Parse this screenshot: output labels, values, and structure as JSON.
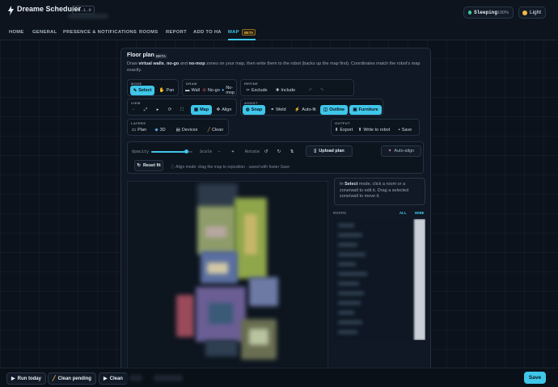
{
  "app": {
    "title": "Dreame Scheduler",
    "version": "v0.1.0"
  },
  "status": {
    "state": "Sleeping",
    "battery": "100%"
  },
  "theme": {
    "label": "Light"
  },
  "nav": {
    "items": [
      "HOME",
      "GENERAL",
      "PRESENCE & NOTIFICATIONS",
      "ROOMS",
      "REPORT",
      "ADD TO HA",
      "MAP"
    ],
    "active": "MAP",
    "map_badge": "BETA"
  },
  "panel": {
    "title": "Floor plan",
    "badge": "BETA",
    "desc_pre": "Draw ",
    "desc_walls": "virtual walls",
    "desc_mid1": ", ",
    "desc_nogo": "no-go",
    "desc_mid2": " and ",
    "desc_nomop": "no-mop",
    "desc_post": " zones on your map, then write them to the robot (backs up the map first). Coordinates match the robot's map exactly."
  },
  "toolbar": {
    "mode": {
      "label": "MODE",
      "select": "Select",
      "pan": "Pan"
    },
    "draw": {
      "label": "DRAW",
      "wall": "Wall",
      "nogo": "No-go",
      "nomop": "No-mop"
    },
    "refine": {
      "label": "REFINE",
      "exclude": "Exclude",
      "include": "Include",
      "undo": "↶",
      "redo": "↷"
    },
    "view": {
      "label": "VIEW",
      "zoom_out": "-",
      "fit": "⤢",
      "rotate": "▸",
      "reload": "⟳",
      "fullscreen": "⛶",
      "map": "Map",
      "align": "Align"
    },
    "assist": {
      "label": "ASSIST",
      "snap": "Snap",
      "weld": "Weld",
      "autofit": "Auto-fit",
      "outline": "Outline",
      "furniture": "Furniture"
    },
    "layers": {
      "label": "LAYERS",
      "plan": "Plan",
      "threed": "3D",
      "devices": "Devices",
      "clean": "Clean"
    },
    "output": {
      "label": "OUTPUT",
      "export": "Export",
      "write": "Write to robot",
      "save": "Save"
    }
  },
  "controls": {
    "opacity_label": "Opacity",
    "opacity_value": 0.85,
    "scale_label": "Scale",
    "scale_minus": "-",
    "scale_plus": "+",
    "rotate_label": "Rotate",
    "upload": "Upload plan",
    "autoalign": "Auto-align",
    "reset": "Reset fit",
    "align_hint": "Align mode: drag the map to reposition · saved with footer Save"
  },
  "hint": {
    "pre": "In ",
    "mode": "Select",
    "post": " mode, click a room or a zone/wall to edit it. Drag a selected zone/wall to move it."
  },
  "rooms": {
    "label": "ROOMS",
    "all": "ALL",
    "sep": "·",
    "none": "NONE"
  },
  "footer": {
    "run_today": "Run today",
    "clean_pending": "Clean pending",
    "clean": "Clean",
    "save": "Save"
  },
  "colors": {
    "accent": "#3fc6e8",
    "background": "#0b121c",
    "status_ok": "#37d39a"
  }
}
